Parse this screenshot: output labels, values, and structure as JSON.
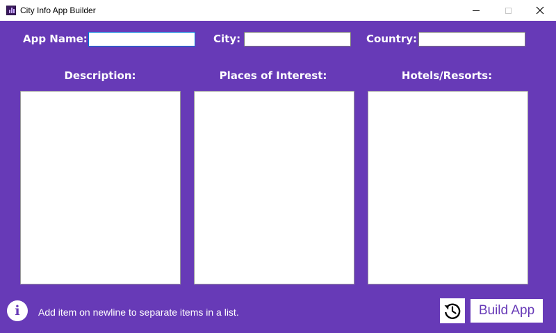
{
  "window": {
    "title": "City Info App Builder"
  },
  "form": {
    "app_name_label": "App Name:",
    "app_name_value": "",
    "city_label": "City:",
    "city_value": "",
    "country_label": "Country:",
    "country_value": ""
  },
  "columns": {
    "description_label": "Description:",
    "places_label": "Places of Interest:",
    "hotels_label": "Hotels/Resorts:"
  },
  "footer": {
    "info_glyph": "i",
    "hint_text": "Add item on newline to separate items in a list.",
    "build_label": "Build App"
  },
  "colors": {
    "accent": "#673ab7",
    "panel": "#ffffff"
  }
}
